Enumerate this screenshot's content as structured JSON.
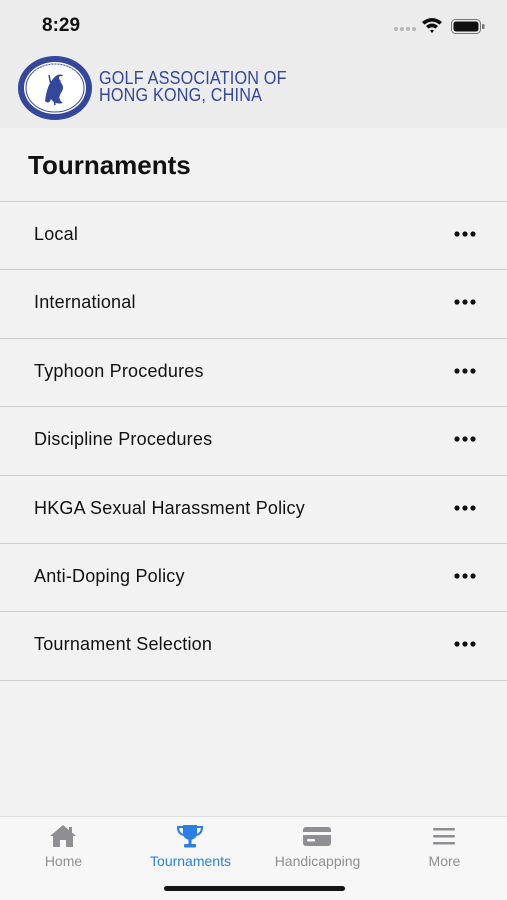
{
  "status_bar": {
    "time": "8:29"
  },
  "header": {
    "logo_line1": "GOLF ASSOCIATION OF",
    "logo_line2": "HONG KONG, CHINA",
    "seal_text": "GOLF ASSOCIATION OF HONG KONG, CHINA"
  },
  "page": {
    "title": "Tournaments"
  },
  "menu": {
    "items": [
      {
        "label": "Local"
      },
      {
        "label": "International"
      },
      {
        "label": "Typhoon Procedures"
      },
      {
        "label": "Discipline Procedures"
      },
      {
        "label": "HKGA Sexual Harassment Policy"
      },
      {
        "label": "Anti-Doping Policy"
      },
      {
        "label": "Tournament Selection"
      }
    ],
    "item_icon": "more-dots-icon"
  },
  "tab_bar": {
    "tabs": [
      {
        "label": "Home",
        "icon": "house-icon",
        "active": false
      },
      {
        "label": "Tournaments",
        "icon": "trophy-icon",
        "active": true
      },
      {
        "label": "Handicapping",
        "icon": "card-icon",
        "active": false
      },
      {
        "label": "More",
        "icon": "hamburger-icon",
        "active": false
      }
    ]
  },
  "colors": {
    "brand_blue": "#34479a",
    "active_tab": "#2b7fe0",
    "inactive_tab": "#8e8e93"
  }
}
